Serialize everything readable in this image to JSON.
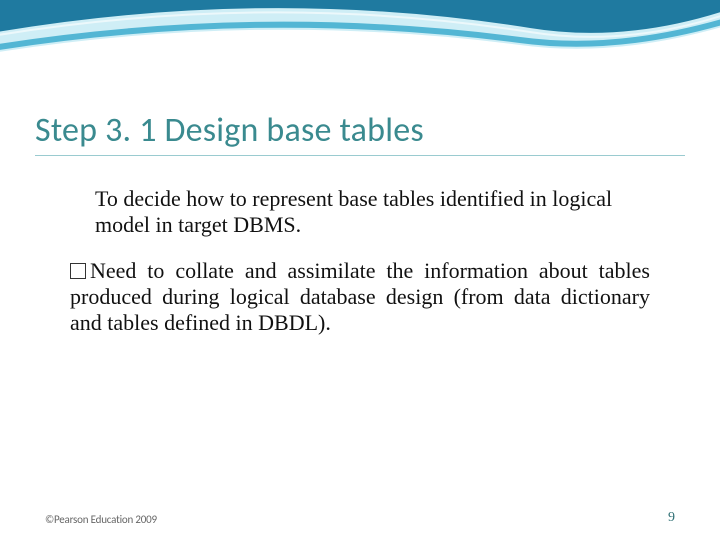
{
  "title": "Step 3. 1  Design base tables",
  "para1": "To decide how to represent base tables identified in logical model in target DBMS.",
  "para2": "Need to collate and assimilate the information about tables produced during logical database design (from data dictionary and tables defined in DBDL).",
  "footer_left": "©Pearson Education 2009",
  "footer_right": "9",
  "colors": {
    "title": "#3a8a8f",
    "underline": "#9acbd0",
    "swoosh_dark": "#1f7aa0",
    "swoosh_light": "#8fd4e8"
  }
}
